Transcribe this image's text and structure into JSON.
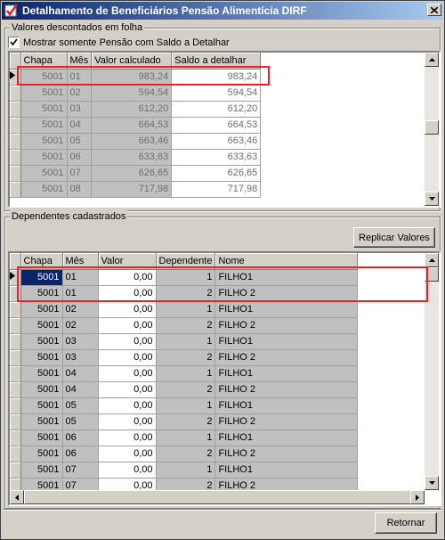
{
  "window": {
    "title": "Detalhamento de Beneficiários Pensão Alimentícia DIRF"
  },
  "top_group": {
    "title": "Valores descontados em folha",
    "checkbox_label": "Mostrar somente Pensão com Saldo a Detalhar",
    "checkbox_checked": true,
    "columns": [
      "Chapa",
      "Mês",
      "Valor calculado",
      "Saldo a detalhar"
    ],
    "rows": [
      {
        "chapa": "5001",
        "mes": "01",
        "valor": "983,24",
        "saldo": "983,24"
      },
      {
        "chapa": "5001",
        "mes": "02",
        "valor": "594,54",
        "saldo": "594,54"
      },
      {
        "chapa": "5001",
        "mes": "03",
        "valor": "612,20",
        "saldo": "612,20"
      },
      {
        "chapa": "5001",
        "mes": "04",
        "valor": "664,53",
        "saldo": "664,53"
      },
      {
        "chapa": "5001",
        "mes": "05",
        "valor": "663,46",
        "saldo": "663,46"
      },
      {
        "chapa": "5001",
        "mes": "06",
        "valor": "633,63",
        "saldo": "633,63"
      },
      {
        "chapa": "5001",
        "mes": "07",
        "valor": "626,65",
        "saldo": "626,65"
      },
      {
        "chapa": "5001",
        "mes": "08",
        "valor": "717,98",
        "saldo": "717,98"
      }
    ]
  },
  "bottom_group": {
    "title": "Dependentes cadastrados",
    "replicate_button": "Replicar Valores",
    "columns": [
      "Chapa",
      "Mês",
      "Valor",
      "Dependente",
      "Nome"
    ],
    "rows": [
      {
        "chapa": "5001",
        "mes": "01",
        "valor": "0,00",
        "dep": "1",
        "nome": "FILHO1"
      },
      {
        "chapa": "5001",
        "mes": "01",
        "valor": "0,00",
        "dep": "2",
        "nome": "FILHO 2"
      },
      {
        "chapa": "5001",
        "mes": "02",
        "valor": "0,00",
        "dep": "1",
        "nome": "FILHO1"
      },
      {
        "chapa": "5001",
        "mes": "02",
        "valor": "0,00",
        "dep": "2",
        "nome": "FILHO 2"
      },
      {
        "chapa": "5001",
        "mes": "03",
        "valor": "0,00",
        "dep": "1",
        "nome": "FILHO1"
      },
      {
        "chapa": "5001",
        "mes": "03",
        "valor": "0,00",
        "dep": "2",
        "nome": "FILHO 2"
      },
      {
        "chapa": "5001",
        "mes": "04",
        "valor": "0,00",
        "dep": "1",
        "nome": "FILHO1"
      },
      {
        "chapa": "5001",
        "mes": "04",
        "valor": "0,00",
        "dep": "2",
        "nome": "FILHO 2"
      },
      {
        "chapa": "5001",
        "mes": "05",
        "valor": "0,00",
        "dep": "1",
        "nome": "FILHO1"
      },
      {
        "chapa": "5001",
        "mes": "05",
        "valor": "0,00",
        "dep": "2",
        "nome": "FILHO 2"
      },
      {
        "chapa": "5001",
        "mes": "06",
        "valor": "0,00",
        "dep": "1",
        "nome": "FILHO1"
      },
      {
        "chapa": "5001",
        "mes": "06",
        "valor": "0,00",
        "dep": "2",
        "nome": "FILHO 2"
      },
      {
        "chapa": "5001",
        "mes": "07",
        "valor": "0,00",
        "dep": "1",
        "nome": "FILHO1"
      },
      {
        "chapa": "5001",
        "mes": "07",
        "valor": "0,00",
        "dep": "2",
        "nome": "FILHO 2"
      }
    ]
  },
  "footer": {
    "return_button": "Retornar"
  },
  "colors": {
    "highlight": "#e8202a",
    "titlebar": "#0a246a",
    "selection": "#0a246a"
  }
}
